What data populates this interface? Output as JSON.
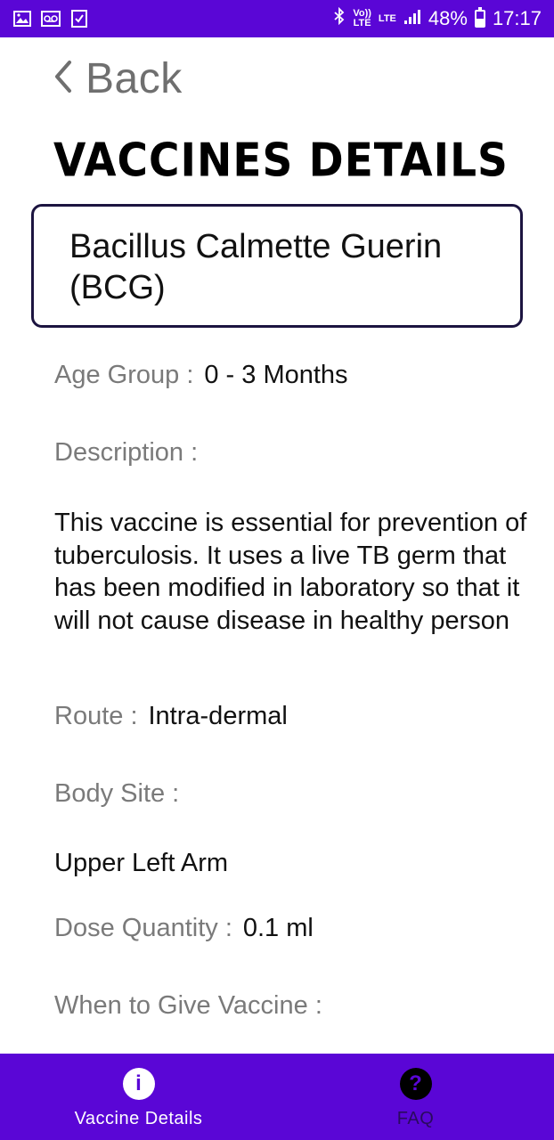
{
  "status_bar": {
    "battery": "48%",
    "battery_level": 0.48,
    "time": "17:17",
    "volte_label": "Vo))\nLTE",
    "lte_label": "LTE",
    "icons": [
      "gallery-icon",
      "voicemail-icon",
      "checklist-icon",
      "bluetooth-icon",
      "signal-icon",
      "battery-icon"
    ]
  },
  "back": {
    "label": "Back"
  },
  "page": {
    "title": "Vaccines Details"
  },
  "vaccine": {
    "name": "Bacillus Calmette Guerin (BCG)",
    "age_group_label": "Age Group :",
    "age_group_value": "0 - 3 Months",
    "description_label": "Description :",
    "description_text": "This vaccine is essential for prevention of tuberculosis. It uses a live TB germ that has been modified in laboratory so that it will not cause disease in healthy person",
    "route_label": "Route :",
    "route_value": "Intra-dermal",
    "body_site_label": "Body Site :",
    "body_site_value": "Upper Left Arm",
    "dose_label": "Dose Quantity :",
    "dose_value": "0.1 ml",
    "when_label": "When to Give Vaccine :"
  },
  "bottom_nav": {
    "items": [
      {
        "label": "Vaccine Details",
        "icon": "info-icon",
        "glyph": "i",
        "active": true
      },
      {
        "label": "FAQ",
        "icon": "help-icon",
        "glyph": "?",
        "active": false
      }
    ]
  },
  "colors": {
    "accent": "#5a06d6",
    "label_gray": "#7a7a7a",
    "box_border": "#1c1440"
  }
}
